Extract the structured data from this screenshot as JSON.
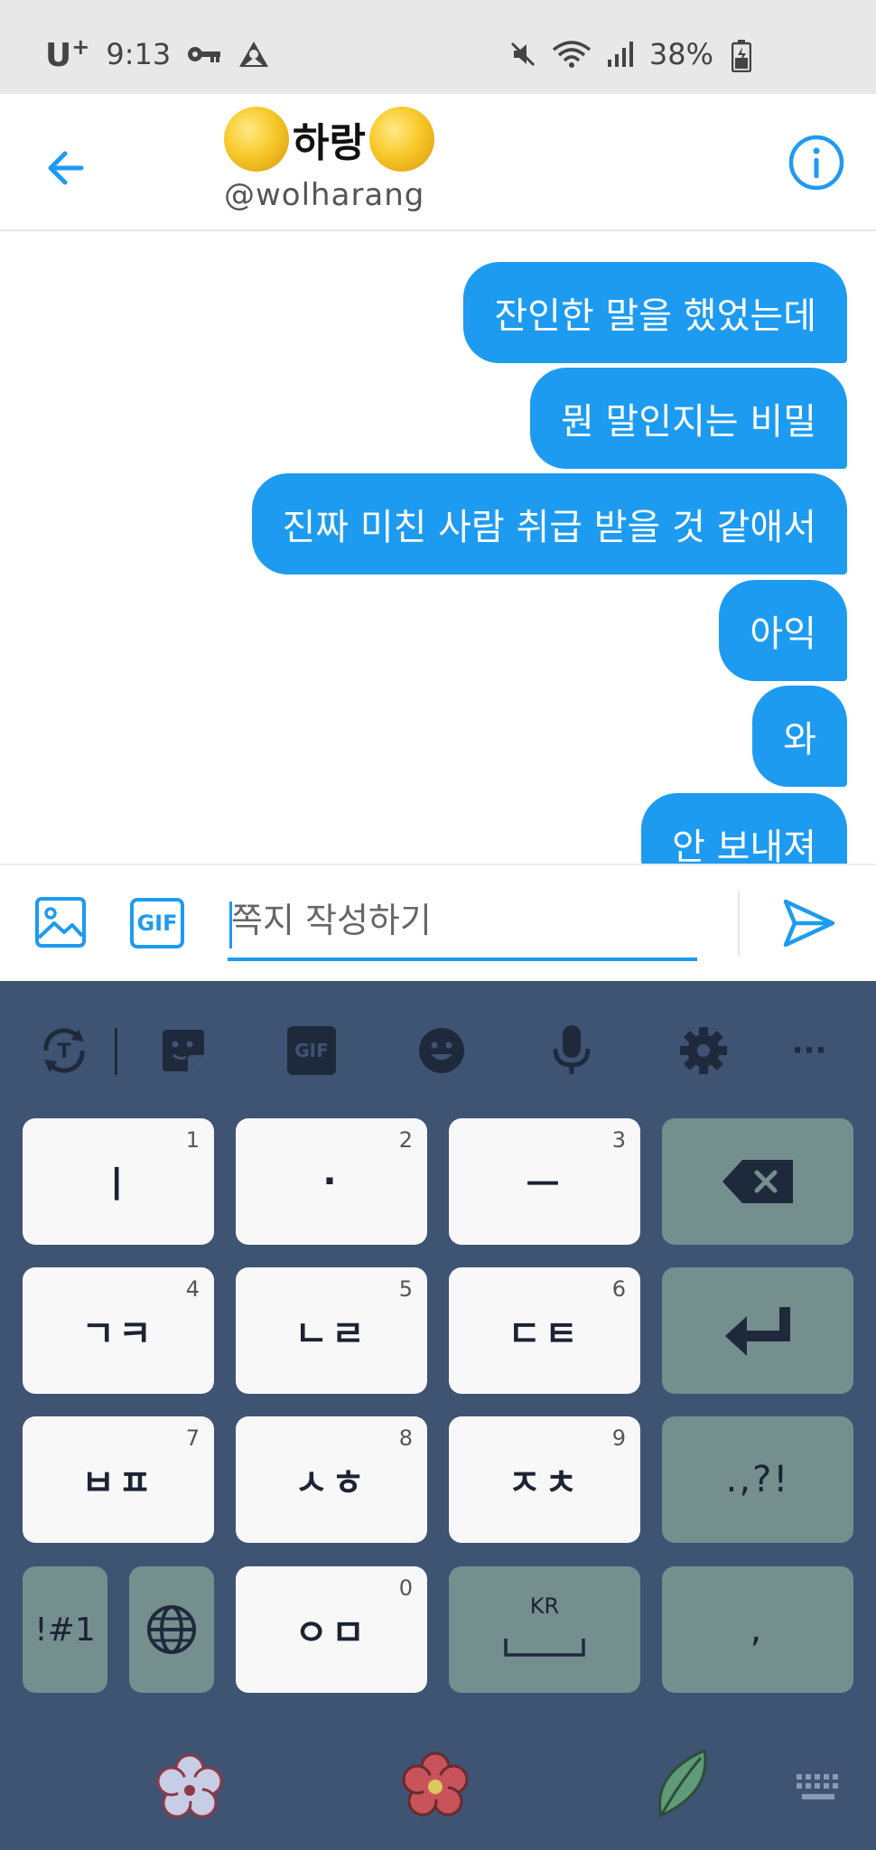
{
  "status_bar": {
    "carrier": "U",
    "carrier_sup": "+",
    "time": "9:13",
    "battery": "38%"
  },
  "header": {
    "name": "하랑",
    "handle": "@wolharang"
  },
  "messages": [
    {
      "text": "잔인한 말을 했었는데"
    },
    {
      "text": "뭔 말인지는 비밀"
    },
    {
      "text": "진짜 미친 사람 취급 받을 것 같애서"
    },
    {
      "text": "아익"
    },
    {
      "text": "와"
    },
    {
      "text": "안 보내져"
    }
  ],
  "compose": {
    "gif_label": "GIF",
    "placeholder": "쪽지 작성하기"
  },
  "keyboard": {
    "toolbar_gif": "GIF",
    "toolbar_more": "···",
    "keys": {
      "k1": {
        "label": "ㅣ",
        "num": "1"
      },
      "k2": {
        "label": "·",
        "num": "2"
      },
      "k3": {
        "label": "ㅡ",
        "num": "3"
      },
      "k4": {
        "label": "ㄱㅋ",
        "num": "4"
      },
      "k5": {
        "label": "ㄴㄹ",
        "num": "5"
      },
      "k6": {
        "label": "ㄷㅌ",
        "num": "6"
      },
      "k7": {
        "label": "ㅂㅍ",
        "num": "7"
      },
      "k8": {
        "label": "ㅅㅎ",
        "num": "8"
      },
      "k9": {
        "label": "ㅈㅊ",
        "num": "9"
      },
      "k0": {
        "label": "ㅇㅁ",
        "num": "0"
      },
      "punct": ".,?!",
      "symbols": "!#1",
      "space_lang": "KR",
      "comma": ","
    }
  },
  "colors": {
    "accent": "#1d9bf0",
    "keyboard_bg": "#3f5373",
    "key_func": "#758f8f"
  }
}
